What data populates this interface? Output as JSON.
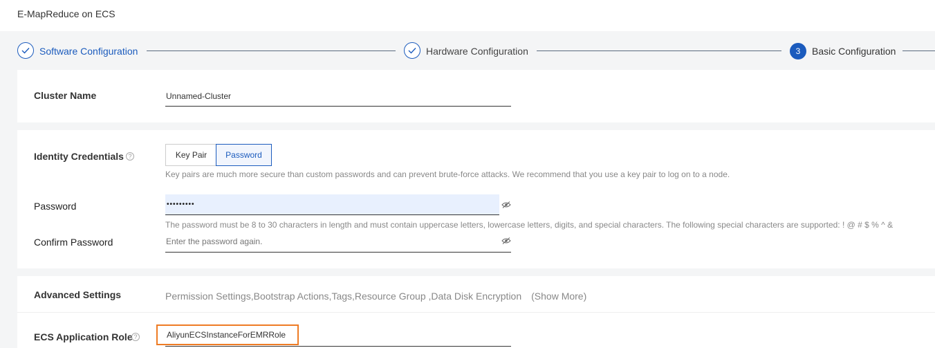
{
  "header": {
    "title": "E-MapReduce on ECS"
  },
  "steps": [
    {
      "label": "Software Configuration",
      "state": "done"
    },
    {
      "label": "Hardware Configuration",
      "state": "done"
    },
    {
      "label": "Basic Configuration",
      "state": "active",
      "number": "3"
    }
  ],
  "cluster": {
    "label": "Cluster Name",
    "value": "Unnamed-Cluster"
  },
  "identity": {
    "label": "Identity Credentials",
    "options": [
      "Key Pair",
      "Password"
    ],
    "selected": "Password",
    "hint": "Key pairs are much more secure than custom passwords and can prevent brute-force attacks. We recommend that you use a key pair to log on to a node."
  },
  "password": {
    "label": "Password",
    "masked_value": "•••••••••",
    "hint": "The password must be 8 to 30 characters in length and must contain uppercase letters, lowercase letters, digits, and special characters. The following special characters are supported: ! @ # $ % ^ &"
  },
  "confirm_password": {
    "label": "Confirm Password",
    "placeholder": "Enter the password again."
  },
  "advanced": {
    "label": "Advanced Settings",
    "summary": "Permission Settings,Bootstrap Actions,Tags,Resource Group ,Data Disk Encryption　(Show More)"
  },
  "ecs_role": {
    "label": "ECS Application Role",
    "value": "AliyunECSInstanceForEMRRole"
  },
  "colors": {
    "accent": "#1b5bbd",
    "highlight": "#ee7b24",
    "autofill": "#e8f0fe"
  }
}
